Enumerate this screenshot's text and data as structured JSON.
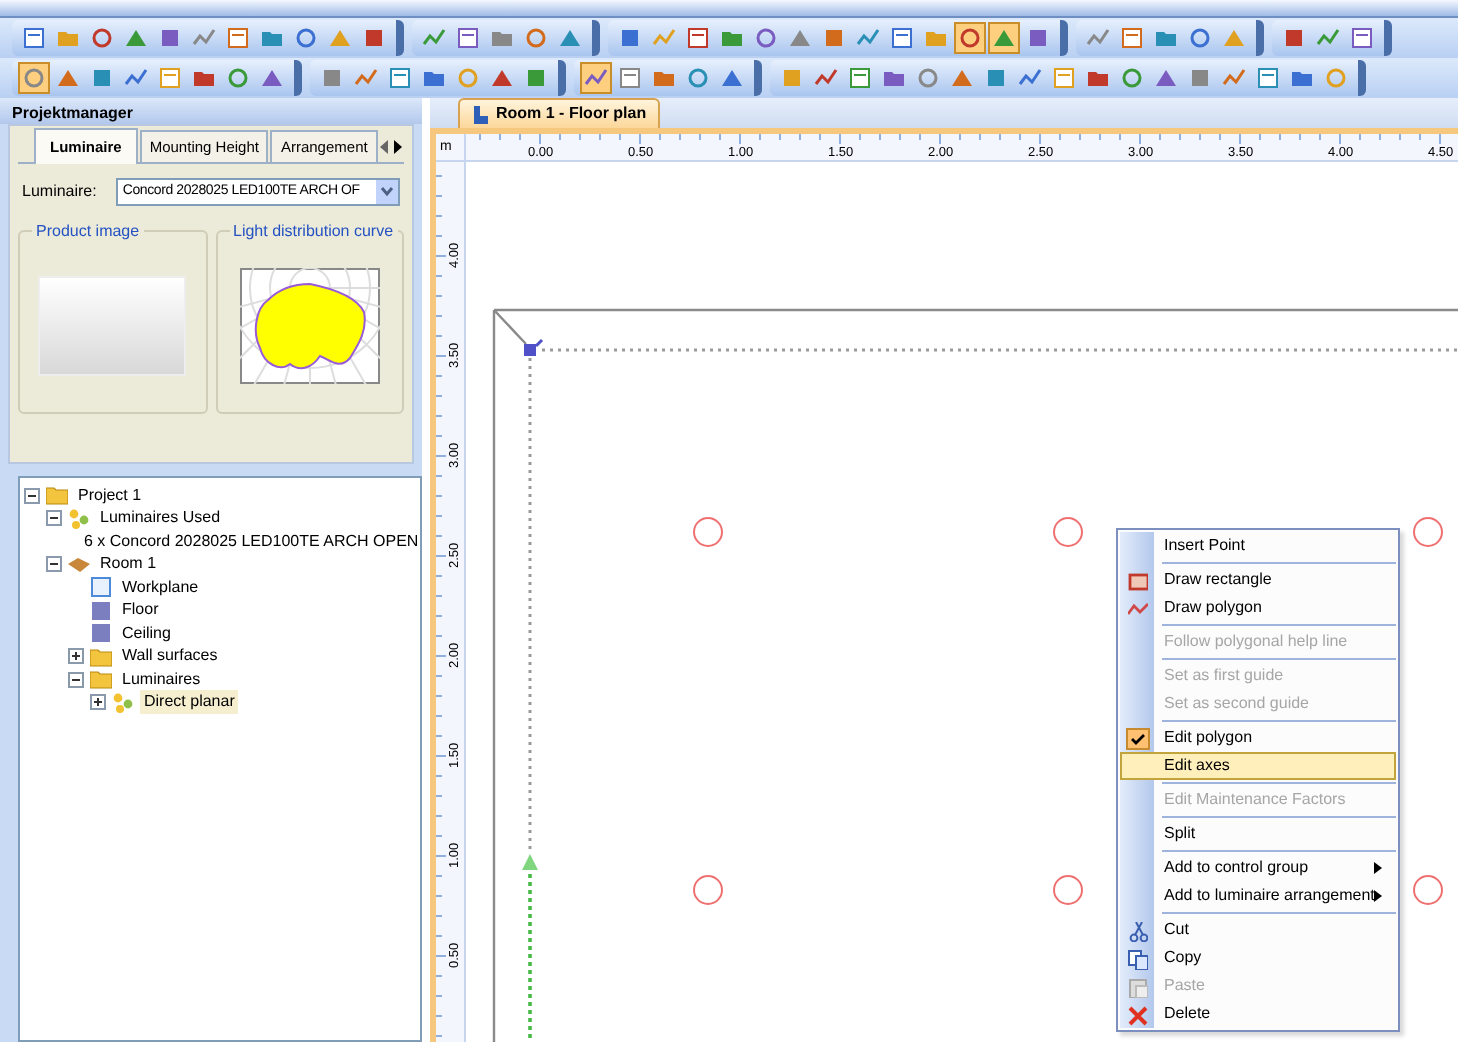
{
  "toolbars": [
    {
      "groups": [
        {
          "pressed": [
            false,
            false,
            false,
            false,
            false,
            false,
            false,
            false,
            false,
            false,
            false
          ]
        },
        {
          "pressed": [
            false,
            false,
            false,
            false,
            false
          ]
        },
        {
          "pressed": [
            false,
            false,
            false,
            false,
            false,
            false,
            false,
            false,
            false,
            false,
            true,
            true,
            false
          ]
        },
        {
          "pressed": [
            false,
            false,
            false,
            false,
            false
          ]
        },
        {
          "pressed": [
            false,
            false,
            false
          ]
        }
      ]
    },
    {
      "groups": [
        {
          "pressed": [
            true,
            false,
            false,
            false,
            false,
            false,
            false,
            false
          ]
        },
        {
          "pressed": [
            false,
            false,
            false,
            false,
            false,
            false,
            false
          ]
        },
        {
          "pressed": [
            true,
            false,
            false,
            false,
            false
          ]
        },
        {
          "pressed": [
            false,
            false,
            false,
            false,
            false,
            false,
            false,
            false,
            false,
            false,
            false,
            false,
            false,
            false,
            false,
            false,
            false
          ]
        }
      ]
    }
  ],
  "project_manager": {
    "title": "Projektmanager",
    "tabs": [
      {
        "label": "Luminaire",
        "selected": true
      },
      {
        "label": "Mounting Height",
        "selected": false
      },
      {
        "label": "Arrangement",
        "selected": false
      }
    ],
    "luminaire_label": "Luminaire:",
    "luminaire_value": "Concord 2028025 LED100TE ARCH OF",
    "product_image_title": "Product image",
    "curve_title": "Light distribution curve",
    "tree": [
      {
        "label": "Project 1",
        "kind": "folder",
        "expanded": true,
        "selected": false,
        "children": [
          {
            "label": "Luminaires Used",
            "kind": "group",
            "expanded": true,
            "selected": false,
            "children": [
              {
                "label": "6 x Concord 2028025 LED100TE ARCH OPEN",
                "kind": "luminaire",
                "selected": false
              }
            ]
          },
          {
            "label": "Room 1",
            "kind": "room",
            "expanded": true,
            "selected": false,
            "children": [
              {
                "label": "Workplane",
                "kind": "plane",
                "selected": false
              },
              {
                "label": "Floor",
                "kind": "surface",
                "selected": false
              },
              {
                "label": "Ceiling",
                "kind": "surface",
                "selected": false
              },
              {
                "label": "Wall surfaces",
                "kind": "folder",
                "expanded": false,
                "selected": false
              },
              {
                "label": "Luminaires",
                "kind": "folder",
                "expanded": true,
                "selected": false,
                "children": [
                  {
                    "label": "Direct planar",
                    "kind": "group",
                    "expanded": false,
                    "selected": true
                  }
                ]
              }
            ]
          }
        ]
      }
    ]
  },
  "document": {
    "tab": "Room 1 - Floor plan",
    "unit": "m",
    "top_ruler": [
      "0.00",
      "0.50",
      "1.00",
      "1.50",
      "2.00",
      "2.50",
      "3.00",
      "3.50",
      "4.00",
      "4.50"
    ],
    "left_ruler": [
      "4.00",
      "3.50",
      "3.00",
      "2.50",
      "2.00",
      "1.50",
      "1.00",
      "0.50"
    ]
  },
  "context_menu": [
    {
      "label": "Insert Point",
      "kind": "plain",
      "disabled": false,
      "checked": false,
      "selected": false,
      "submenu": false
    },
    {
      "kind": "separator"
    },
    {
      "label": "Draw rectangle",
      "kind": "rectangle",
      "disabled": false,
      "checked": false,
      "selected": false,
      "submenu": false
    },
    {
      "label": "Draw polygon",
      "kind": "polygon",
      "disabled": false,
      "checked": false,
      "selected": false,
      "submenu": false
    },
    {
      "kind": "separator"
    },
    {
      "label": "Follow polygonal help line",
      "kind": "plain",
      "disabled": true,
      "checked": false,
      "selected": false,
      "submenu": false
    },
    {
      "kind": "separator"
    },
    {
      "label": "Set as first guide",
      "kind": "plain",
      "disabled": true,
      "checked": false,
      "selected": false,
      "submenu": false
    },
    {
      "label": "Set as second guide",
      "kind": "plain",
      "disabled": true,
      "checked": false,
      "selected": false,
      "submenu": false
    },
    {
      "kind": "separator"
    },
    {
      "label": "Edit polygon",
      "kind": "plain",
      "disabled": false,
      "checked": true,
      "selected": false,
      "submenu": false
    },
    {
      "label": "Edit axes",
      "kind": "plain",
      "disabled": false,
      "checked": false,
      "selected": true,
      "submenu": false
    },
    {
      "kind": "separator"
    },
    {
      "label": "Edit Maintenance Factors",
      "kind": "plain",
      "disabled": true,
      "checked": false,
      "selected": false,
      "submenu": false
    },
    {
      "kind": "separator"
    },
    {
      "label": "Split",
      "kind": "plain",
      "disabled": false,
      "checked": false,
      "selected": false,
      "submenu": false
    },
    {
      "kind": "separator"
    },
    {
      "label": "Add to control group",
      "kind": "plain",
      "disabled": false,
      "checked": false,
      "selected": false,
      "submenu": true
    },
    {
      "label": "Add to luminaire arrangement",
      "kind": "plain",
      "disabled": false,
      "checked": false,
      "selected": false,
      "submenu": true
    },
    {
      "kind": "separator"
    },
    {
      "label": "Cut",
      "kind": "cut",
      "disabled": false,
      "checked": false,
      "selected": false,
      "submenu": false
    },
    {
      "label": "Copy",
      "kind": "copy",
      "disabled": false,
      "checked": false,
      "selected": false,
      "submenu": false
    },
    {
      "label": "Paste",
      "kind": "paste",
      "disabled": true,
      "checked": false,
      "selected": false,
      "submenu": false
    },
    {
      "label": "Delete",
      "kind": "delete",
      "disabled": false,
      "checked": false,
      "selected": false,
      "submenu": false
    }
  ]
}
